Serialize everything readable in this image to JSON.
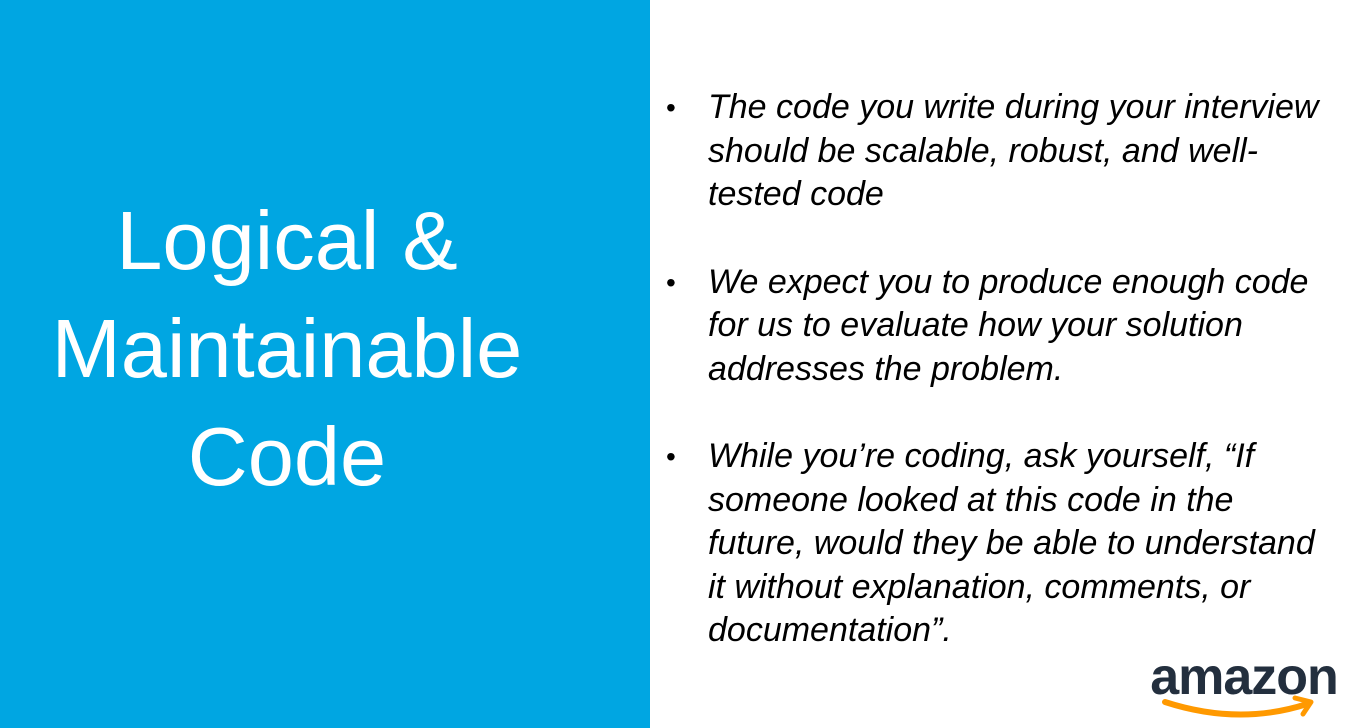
{
  "title": {
    "lines": [
      "Logical &",
      "Maintainable",
      "Code"
    ]
  },
  "bullets": [
    {
      "lines": [
        "The code you write during your interview",
        "should be scalable, robust, and well-",
        "tested code"
      ]
    },
    {
      "lines": [
        "We expect you to produce enough code",
        "for us to evaluate how your solution",
        "addresses the problem."
      ]
    },
    {
      "lines": [
        "While you’re coding, ask yourself, “If",
        "someone looked at this code in the",
        "future, would they be able to understand",
        "it without explanation, comments, or",
        "documentation”."
      ]
    }
  ],
  "bullet_glyph": "•",
  "logo": {
    "text": "amazon",
    "text_color": "#232f3e",
    "smile_color": "#ff9900"
  },
  "colors": {
    "panel_blue": "#00a6e2",
    "title_text": "#ffffff",
    "body_text": "#000000"
  }
}
